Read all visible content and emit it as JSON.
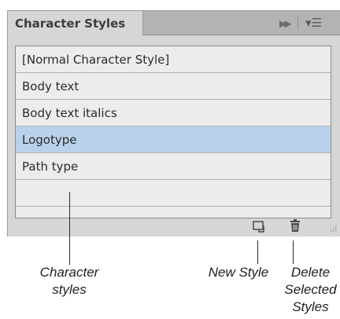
{
  "panel": {
    "tab_title": "Character Styles",
    "collapse_icon": "double-chevron-right-icon",
    "menu_icon": "panel-menu-icon"
  },
  "list": {
    "items": [
      {
        "label": "[Normal Character Style]",
        "selected": false
      },
      {
        "label": "Body text",
        "selected": false
      },
      {
        "label": "Body text italics",
        "selected": false
      },
      {
        "label": "Logotype",
        "selected": true
      },
      {
        "label": "Path type",
        "selected": false
      }
    ],
    "selection_color": "#b9d2ec"
  },
  "toolbar": {
    "new_style_icon": "new-style-icon",
    "delete_icon": "trash-icon"
  },
  "callouts": {
    "character_styles": [
      "Character",
      "styles"
    ],
    "new_style": "New Style",
    "delete_selected": [
      "Delete",
      "Selected",
      "Styles"
    ]
  }
}
